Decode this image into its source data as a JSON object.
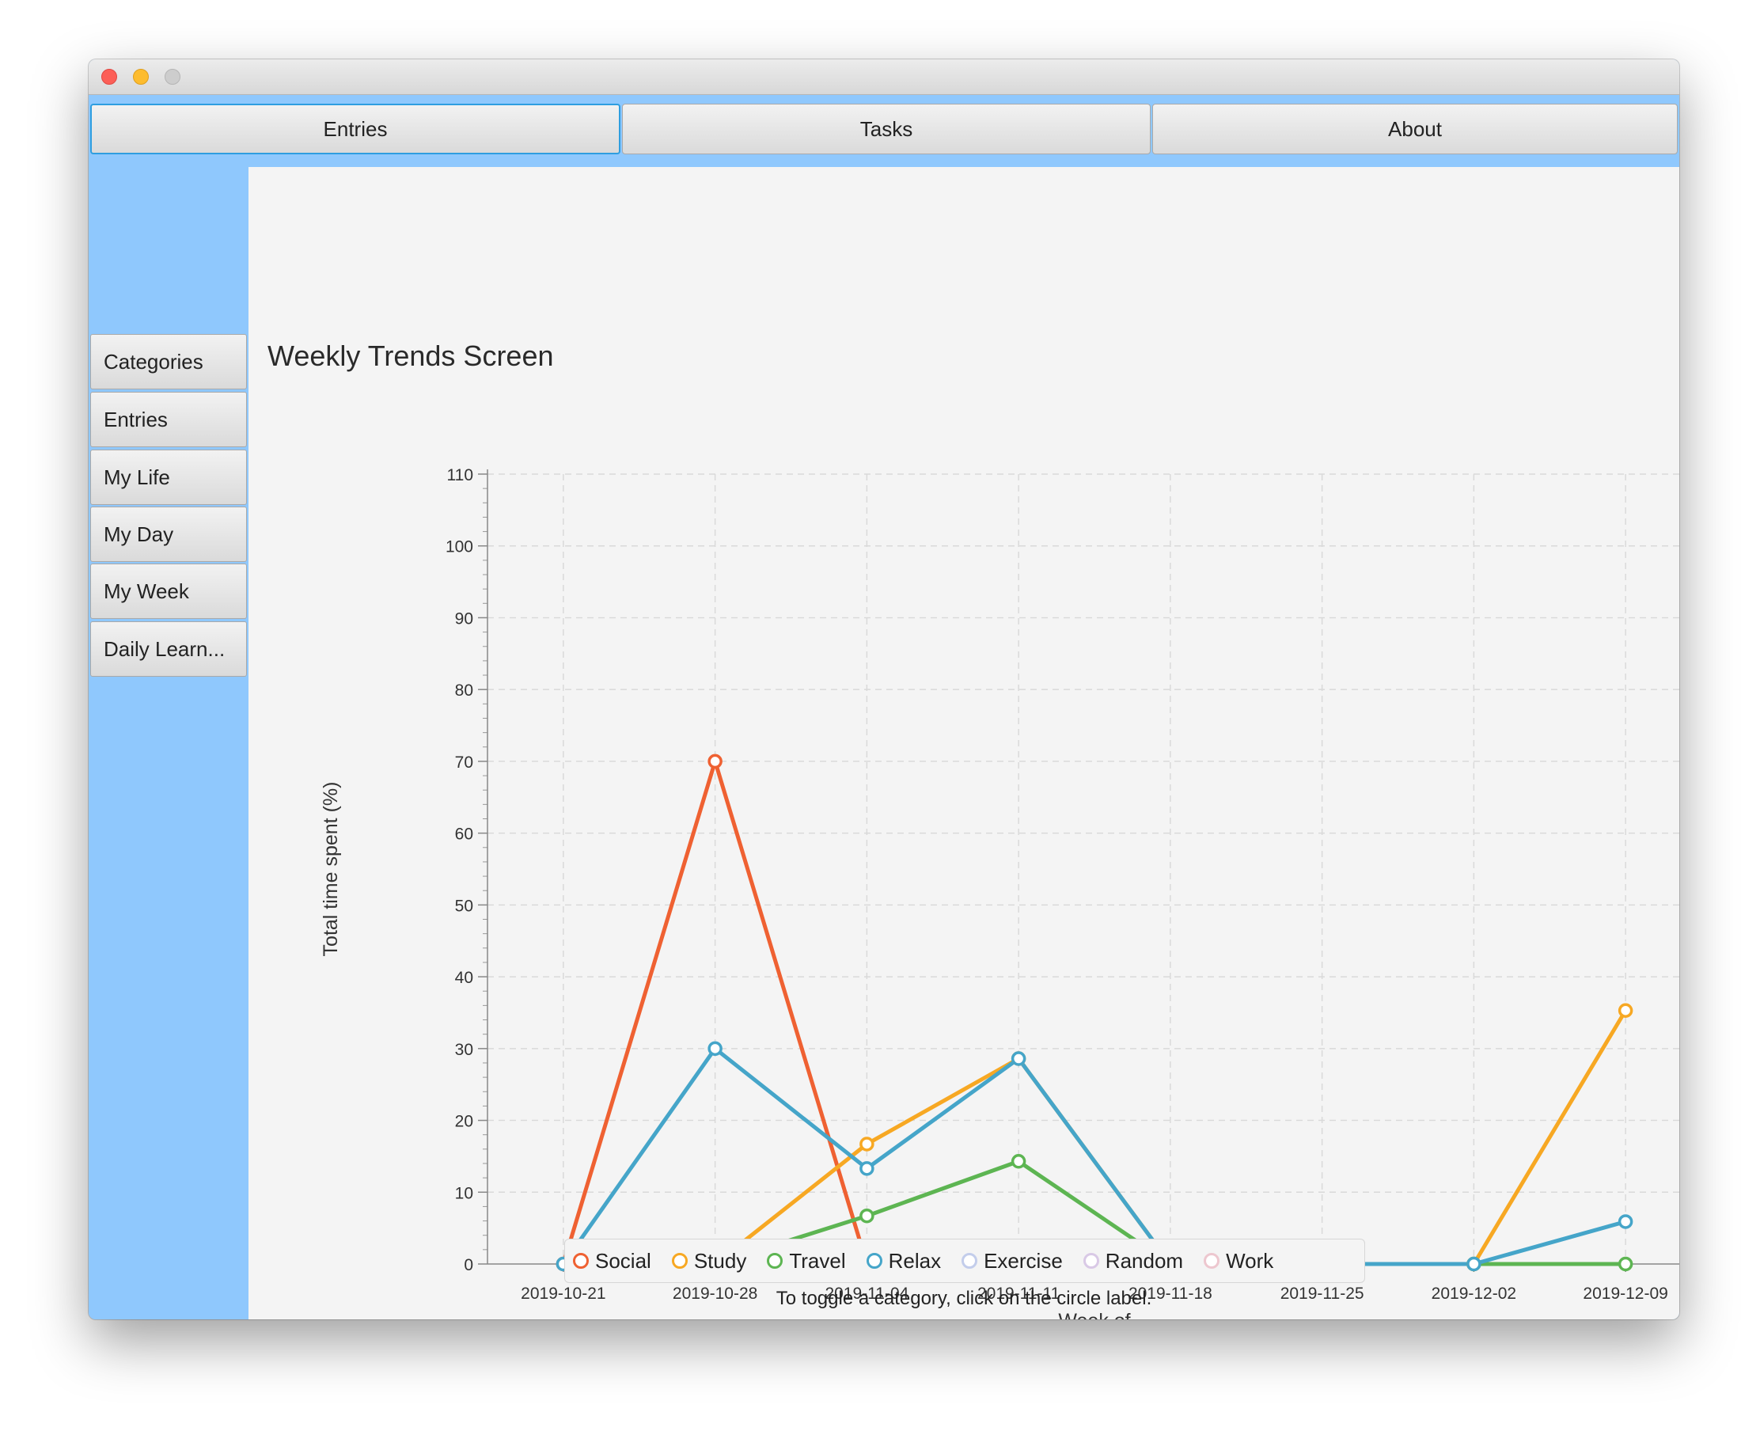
{
  "window": {
    "controls": [
      "close",
      "minimize",
      "zoom"
    ]
  },
  "top_tabs": [
    {
      "label": "Entries",
      "selected": true
    },
    {
      "label": "Tasks",
      "selected": false
    },
    {
      "label": "About",
      "selected": false
    }
  ],
  "sidebar": {
    "items": [
      {
        "label": "Categories"
      },
      {
        "label": "Entries"
      },
      {
        "label": "My Life"
      },
      {
        "label": "My Day"
      },
      {
        "label": "My Week"
      },
      {
        "label": "Daily Learn..."
      }
    ]
  },
  "main": {
    "title": "Weekly Trends Screen",
    "hint": "To toggle a category, click on the circle label."
  },
  "chart_data": {
    "type": "line",
    "title": "",
    "xlabel": "Week of",
    "ylabel": "Total time spent (%)",
    "categories": [
      "2019-10-21",
      "2019-10-28",
      "2019-11-04",
      "2019-11-11",
      "2019-11-18",
      "2019-11-25",
      "2019-12-02",
      "2019-12-09"
    ],
    "ylim": [
      0,
      110
    ],
    "yticks": [
      "0",
      "10",
      "20",
      "30",
      "40",
      "50",
      "60",
      "70",
      "80",
      "90",
      "100",
      "110"
    ],
    "grid": true,
    "legend": "bottom",
    "series": [
      {
        "name": "Social",
        "color": "#ef6132",
        "values": [
          0,
          70,
          0,
          0,
          0,
          null,
          null,
          null
        ],
        "visible": true
      },
      {
        "name": "Study",
        "color": "#f7a823",
        "values": [
          null,
          0,
          16.7,
          28.6,
          0,
          0,
          0,
          35.3
        ],
        "visible": true
      },
      {
        "name": "Travel",
        "color": "#5db552",
        "values": [
          null,
          0,
          6.7,
          14.3,
          0,
          0,
          0,
          0
        ],
        "visible": true
      },
      {
        "name": "Relax",
        "color": "#45a5c9",
        "values": [
          0,
          30,
          13.3,
          28.6,
          0,
          0,
          0,
          5.9
        ],
        "visible": true
      },
      {
        "name": "Exercise",
        "color": "#c3cdeb",
        "values": [],
        "visible": false
      },
      {
        "name": "Random",
        "color": "#d9c9e6",
        "values": [],
        "visible": false
      },
      {
        "name": "Work",
        "color": "#edc7cf",
        "values": [],
        "visible": false
      }
    ]
  }
}
